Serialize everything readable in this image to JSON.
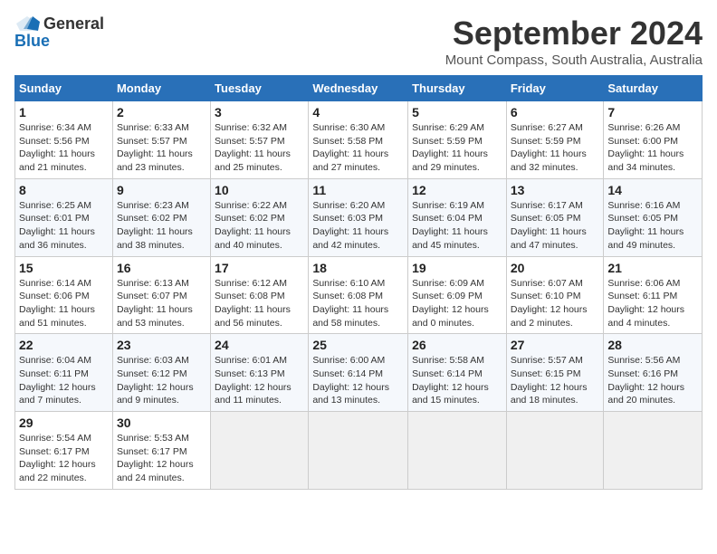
{
  "header": {
    "logo_general": "General",
    "logo_blue": "Blue",
    "month_title": "September 2024",
    "location": "Mount Compass, South Australia, Australia"
  },
  "weekdays": [
    "Sunday",
    "Monday",
    "Tuesday",
    "Wednesday",
    "Thursday",
    "Friday",
    "Saturday"
  ],
  "weeks": [
    [
      {
        "day": "1",
        "lines": [
          "Sunrise: 6:34 AM",
          "Sunset: 5:56 PM",
          "Daylight: 11 hours",
          "and 21 minutes."
        ]
      },
      {
        "day": "2",
        "lines": [
          "Sunrise: 6:33 AM",
          "Sunset: 5:57 PM",
          "Daylight: 11 hours",
          "and 23 minutes."
        ]
      },
      {
        "day": "3",
        "lines": [
          "Sunrise: 6:32 AM",
          "Sunset: 5:57 PM",
          "Daylight: 11 hours",
          "and 25 minutes."
        ]
      },
      {
        "day": "4",
        "lines": [
          "Sunrise: 6:30 AM",
          "Sunset: 5:58 PM",
          "Daylight: 11 hours",
          "and 27 minutes."
        ]
      },
      {
        "day": "5",
        "lines": [
          "Sunrise: 6:29 AM",
          "Sunset: 5:59 PM",
          "Daylight: 11 hours",
          "and 29 minutes."
        ]
      },
      {
        "day": "6",
        "lines": [
          "Sunrise: 6:27 AM",
          "Sunset: 5:59 PM",
          "Daylight: 11 hours",
          "and 32 minutes."
        ]
      },
      {
        "day": "7",
        "lines": [
          "Sunrise: 6:26 AM",
          "Sunset: 6:00 PM",
          "Daylight: 11 hours",
          "and 34 minutes."
        ]
      }
    ],
    [
      {
        "day": "8",
        "lines": [
          "Sunrise: 6:25 AM",
          "Sunset: 6:01 PM",
          "Daylight: 11 hours",
          "and 36 minutes."
        ]
      },
      {
        "day": "9",
        "lines": [
          "Sunrise: 6:23 AM",
          "Sunset: 6:02 PM",
          "Daylight: 11 hours",
          "and 38 minutes."
        ]
      },
      {
        "day": "10",
        "lines": [
          "Sunrise: 6:22 AM",
          "Sunset: 6:02 PM",
          "Daylight: 11 hours",
          "and 40 minutes."
        ]
      },
      {
        "day": "11",
        "lines": [
          "Sunrise: 6:20 AM",
          "Sunset: 6:03 PM",
          "Daylight: 11 hours",
          "and 42 minutes."
        ]
      },
      {
        "day": "12",
        "lines": [
          "Sunrise: 6:19 AM",
          "Sunset: 6:04 PM",
          "Daylight: 11 hours",
          "and 45 minutes."
        ]
      },
      {
        "day": "13",
        "lines": [
          "Sunrise: 6:17 AM",
          "Sunset: 6:05 PM",
          "Daylight: 11 hours",
          "and 47 minutes."
        ]
      },
      {
        "day": "14",
        "lines": [
          "Sunrise: 6:16 AM",
          "Sunset: 6:05 PM",
          "Daylight: 11 hours",
          "and 49 minutes."
        ]
      }
    ],
    [
      {
        "day": "15",
        "lines": [
          "Sunrise: 6:14 AM",
          "Sunset: 6:06 PM",
          "Daylight: 11 hours",
          "and 51 minutes."
        ]
      },
      {
        "day": "16",
        "lines": [
          "Sunrise: 6:13 AM",
          "Sunset: 6:07 PM",
          "Daylight: 11 hours",
          "and 53 minutes."
        ]
      },
      {
        "day": "17",
        "lines": [
          "Sunrise: 6:12 AM",
          "Sunset: 6:08 PM",
          "Daylight: 11 hours",
          "and 56 minutes."
        ]
      },
      {
        "day": "18",
        "lines": [
          "Sunrise: 6:10 AM",
          "Sunset: 6:08 PM",
          "Daylight: 11 hours",
          "and 58 minutes."
        ]
      },
      {
        "day": "19",
        "lines": [
          "Sunrise: 6:09 AM",
          "Sunset: 6:09 PM",
          "Daylight: 12 hours",
          "and 0 minutes."
        ]
      },
      {
        "day": "20",
        "lines": [
          "Sunrise: 6:07 AM",
          "Sunset: 6:10 PM",
          "Daylight: 12 hours",
          "and 2 minutes."
        ]
      },
      {
        "day": "21",
        "lines": [
          "Sunrise: 6:06 AM",
          "Sunset: 6:11 PM",
          "Daylight: 12 hours",
          "and 4 minutes."
        ]
      }
    ],
    [
      {
        "day": "22",
        "lines": [
          "Sunrise: 6:04 AM",
          "Sunset: 6:11 PM",
          "Daylight: 12 hours",
          "and 7 minutes."
        ]
      },
      {
        "day": "23",
        "lines": [
          "Sunrise: 6:03 AM",
          "Sunset: 6:12 PM",
          "Daylight: 12 hours",
          "and 9 minutes."
        ]
      },
      {
        "day": "24",
        "lines": [
          "Sunrise: 6:01 AM",
          "Sunset: 6:13 PM",
          "Daylight: 12 hours",
          "and 11 minutes."
        ]
      },
      {
        "day": "25",
        "lines": [
          "Sunrise: 6:00 AM",
          "Sunset: 6:14 PM",
          "Daylight: 12 hours",
          "and 13 minutes."
        ]
      },
      {
        "day": "26",
        "lines": [
          "Sunrise: 5:58 AM",
          "Sunset: 6:14 PM",
          "Daylight: 12 hours",
          "and 15 minutes."
        ]
      },
      {
        "day": "27",
        "lines": [
          "Sunrise: 5:57 AM",
          "Sunset: 6:15 PM",
          "Daylight: 12 hours",
          "and 18 minutes."
        ]
      },
      {
        "day": "28",
        "lines": [
          "Sunrise: 5:56 AM",
          "Sunset: 6:16 PM",
          "Daylight: 12 hours",
          "and 20 minutes."
        ]
      }
    ],
    [
      {
        "day": "29",
        "lines": [
          "Sunrise: 5:54 AM",
          "Sunset: 6:17 PM",
          "Daylight: 12 hours",
          "and 22 minutes."
        ]
      },
      {
        "day": "30",
        "lines": [
          "Sunrise: 5:53 AM",
          "Sunset: 6:17 PM",
          "Daylight: 12 hours",
          "and 24 minutes."
        ]
      },
      {
        "day": "",
        "lines": []
      },
      {
        "day": "",
        "lines": []
      },
      {
        "day": "",
        "lines": []
      },
      {
        "day": "",
        "lines": []
      },
      {
        "day": "",
        "lines": []
      }
    ]
  ]
}
